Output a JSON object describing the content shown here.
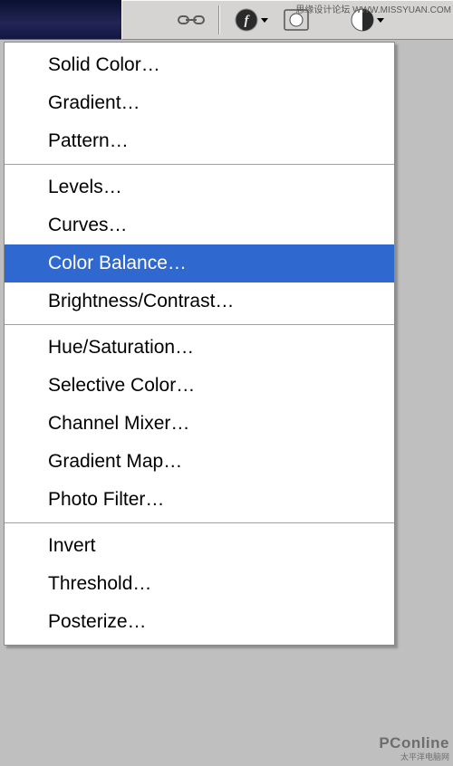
{
  "watermark": {
    "top": "思缘设计论坛 WWW.MISSYUAN.COM",
    "bottom_brand": "PConline",
    "bottom_sub": "太平洋电脑网"
  },
  "toolbar": {
    "icons": [
      {
        "name": "link-icon"
      },
      {
        "name": "fx-icon"
      },
      {
        "name": "mask-icon"
      },
      {
        "name": "adjustment-layer-icon"
      }
    ]
  },
  "menu": {
    "groups": [
      [
        {
          "label": "Solid Color…",
          "highlighted": false
        },
        {
          "label": "Gradient…",
          "highlighted": false
        },
        {
          "label": "Pattern…",
          "highlighted": false
        }
      ],
      [
        {
          "label": "Levels…",
          "highlighted": false
        },
        {
          "label": "Curves…",
          "highlighted": false
        },
        {
          "label": "Color Balance…",
          "highlighted": true
        },
        {
          "label": "Brightness/Contrast…",
          "highlighted": false
        }
      ],
      [
        {
          "label": "Hue/Saturation…",
          "highlighted": false
        },
        {
          "label": "Selective Color…",
          "highlighted": false
        },
        {
          "label": "Channel Mixer…",
          "highlighted": false
        },
        {
          "label": "Gradient Map…",
          "highlighted": false
        },
        {
          "label": "Photo Filter…",
          "highlighted": false
        }
      ],
      [
        {
          "label": "Invert",
          "highlighted": false
        },
        {
          "label": "Threshold…",
          "highlighted": false
        },
        {
          "label": "Posterize…",
          "highlighted": false
        }
      ]
    ]
  }
}
